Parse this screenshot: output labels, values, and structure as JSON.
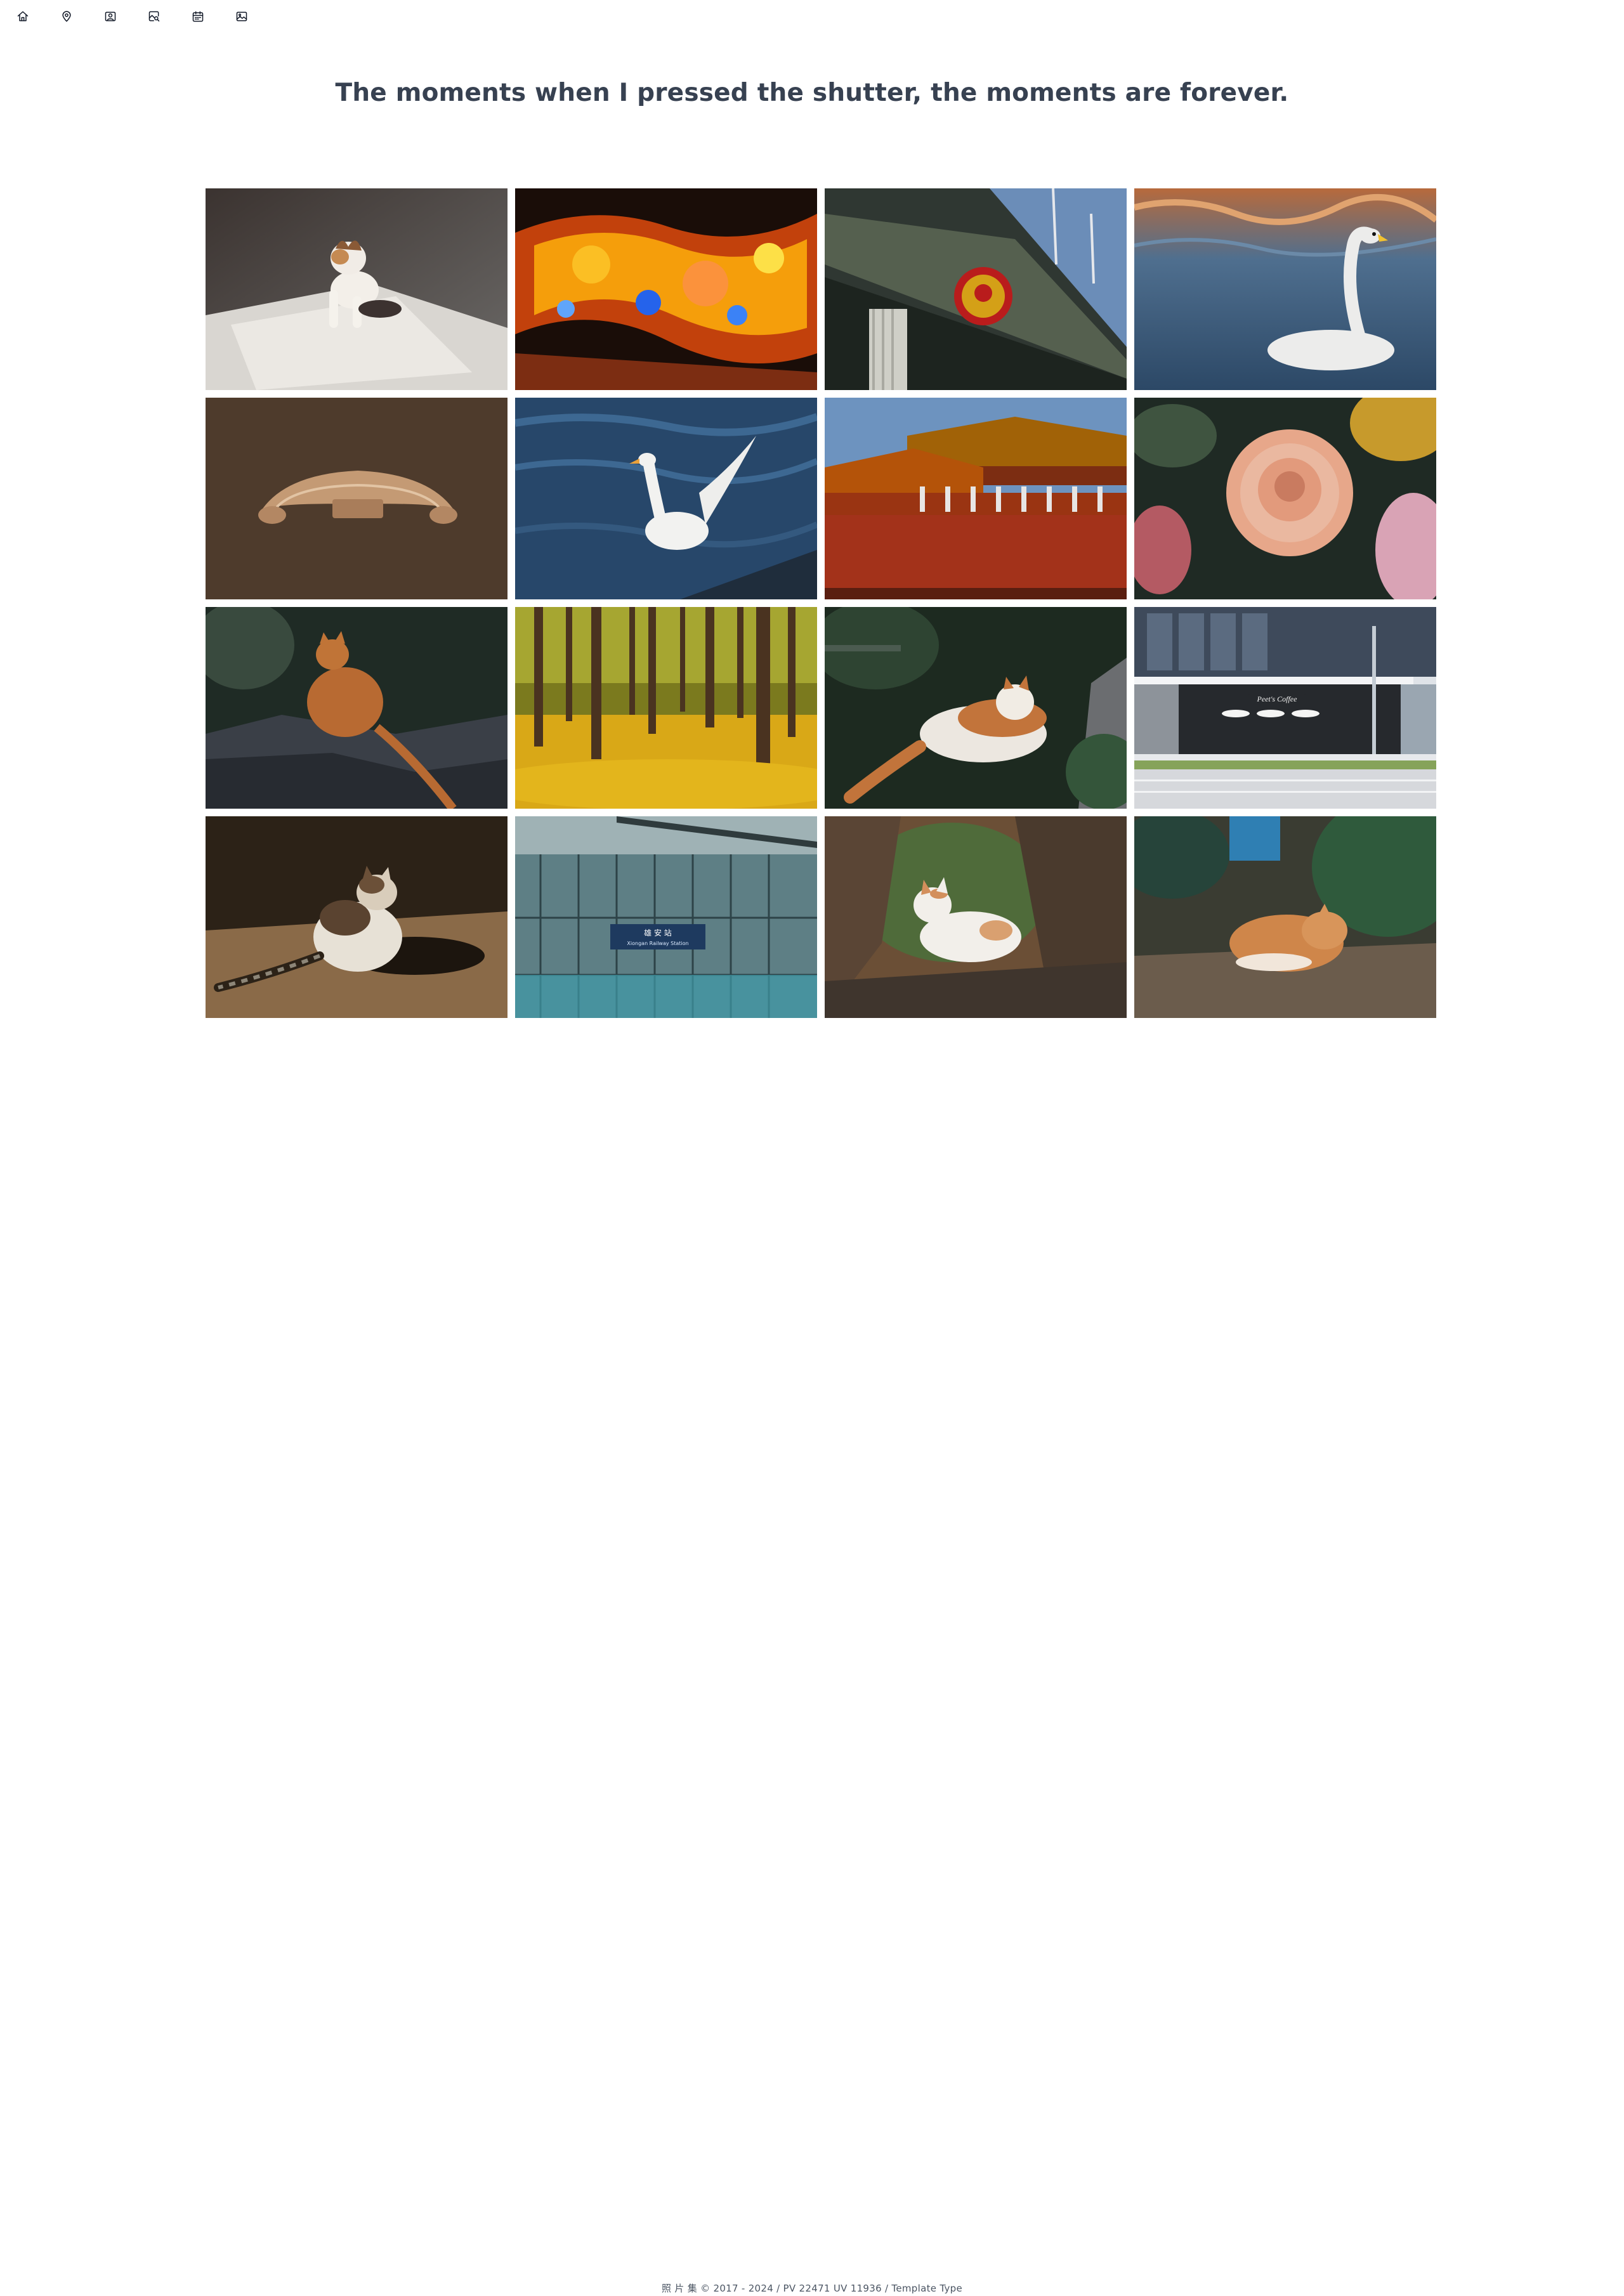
{
  "nav": {
    "items": [
      {
        "icon": "home-icon"
      },
      {
        "icon": "map-pin-icon"
      },
      {
        "icon": "portrait-icon"
      },
      {
        "icon": "image-search-icon"
      },
      {
        "icon": "calendar-icon"
      },
      {
        "icon": "image-icon"
      }
    ]
  },
  "page": {
    "title": "The moments when I pressed the shutter, the moments are forever."
  },
  "gallery": {
    "photos": [
      {
        "subject": "calico kitten on a white mat"
      },
      {
        "subject": "orange festival lantern display"
      },
      {
        "subject": "national emblem on a building facade"
      },
      {
        "subject": "swan on water"
      },
      {
        "subject": "carved wooden ornament"
      },
      {
        "subject": "white goose on blue water"
      },
      {
        "subject": "red palace gate building"
      },
      {
        "subject": "pink chrysanthemum"
      },
      {
        "subject": "orange cat on rocks"
      },
      {
        "subject": "yellow ginkgo forest"
      },
      {
        "subject": "orange and white cat among plants"
      },
      {
        "subject": "modern glass storefront"
      },
      {
        "subject": "calico cat on dirt ground"
      },
      {
        "subject": "subway station glass wall with sign"
      },
      {
        "subject": "white cat between rocks"
      },
      {
        "subject": "orange cat sleeping under leaves"
      }
    ],
    "station_sign": {
      "line1": "雄 安 站",
      "line2": "Xiongan Railway Station"
    },
    "storefront_sign": "Peet's Coffee"
  },
  "footer": {
    "text": "照 片 集 © 2017 - 2024 / PV 22471 UV 11936 / Template Type"
  }
}
